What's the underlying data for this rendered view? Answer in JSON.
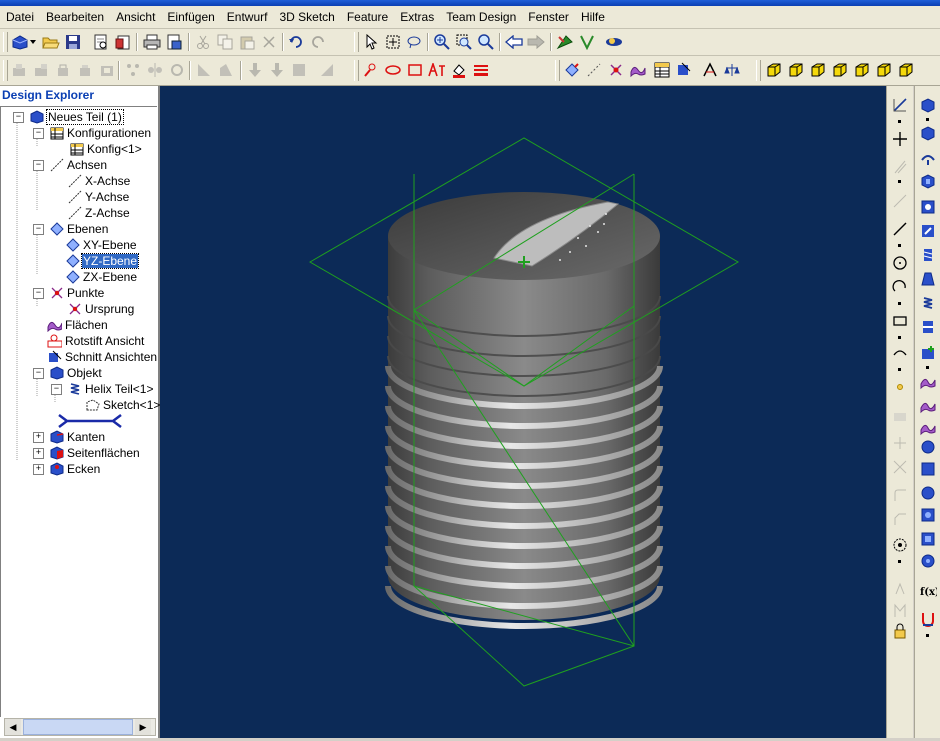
{
  "menu": [
    "Datei",
    "Bearbeiten",
    "Ansicht",
    "Einfügen",
    "Entwurf",
    "3D Sketch",
    "Feature",
    "Extras",
    "Team Design",
    "Fenster",
    "Hilfe"
  ],
  "explorer": {
    "title": "Design Explorer",
    "items": [
      {
        "label": "Neues Teil (1)",
        "icon": "part-icon",
        "expander": "−"
      },
      {
        "label": "Konfigurationen",
        "icon": "table-icon",
        "expander": "−"
      },
      {
        "label": "Konfig<1>",
        "icon": "table-icon"
      },
      {
        "label": "Achsen",
        "icon": "axis-icon",
        "expander": "−"
      },
      {
        "label": "X-Achse",
        "icon": "axis-icon"
      },
      {
        "label": "Y-Achse",
        "icon": "axis-icon"
      },
      {
        "label": "Z-Achse",
        "icon": "axis-icon"
      },
      {
        "label": "Ebenen",
        "icon": "plane-icon",
        "expander": "−"
      },
      {
        "label": "XY-Ebene",
        "icon": "plane-icon"
      },
      {
        "label": "YZ-Ebene",
        "icon": "plane-icon",
        "selected": true
      },
      {
        "label": "ZX-Ebene",
        "icon": "plane-icon"
      },
      {
        "label": "Punkte",
        "icon": "point-icon",
        "expander": "−"
      },
      {
        "label": "Ursprung",
        "icon": "point-icon"
      },
      {
        "label": "Flächen",
        "icon": "surface-icon"
      },
      {
        "label": "Rotstift Ansicht",
        "icon": "redline-icon"
      },
      {
        "label": "Schnitt Ansichten",
        "icon": "section-icon"
      },
      {
        "label": "Objekt",
        "icon": "object-icon",
        "expander": "−"
      },
      {
        "label": "Helix Teil<1>",
        "icon": "helix-icon",
        "expander": "−"
      },
      {
        "label": "Sketch<1>",
        "icon": "sketch-icon"
      },
      {
        "label": "Kanten",
        "icon": "edges-icon",
        "expander": "+"
      },
      {
        "label": "Seitenflächen",
        "icon": "faces-icon",
        "expander": "+"
      },
      {
        "label": "Ecken",
        "icon": "vertices-icon",
        "expander": "+"
      }
    ]
  },
  "colors": {
    "viewport_bg": "#0c2a57",
    "plane_outline": "#1fa01f",
    "selection_bg": "#316ac5",
    "tree_text": "#000000"
  }
}
